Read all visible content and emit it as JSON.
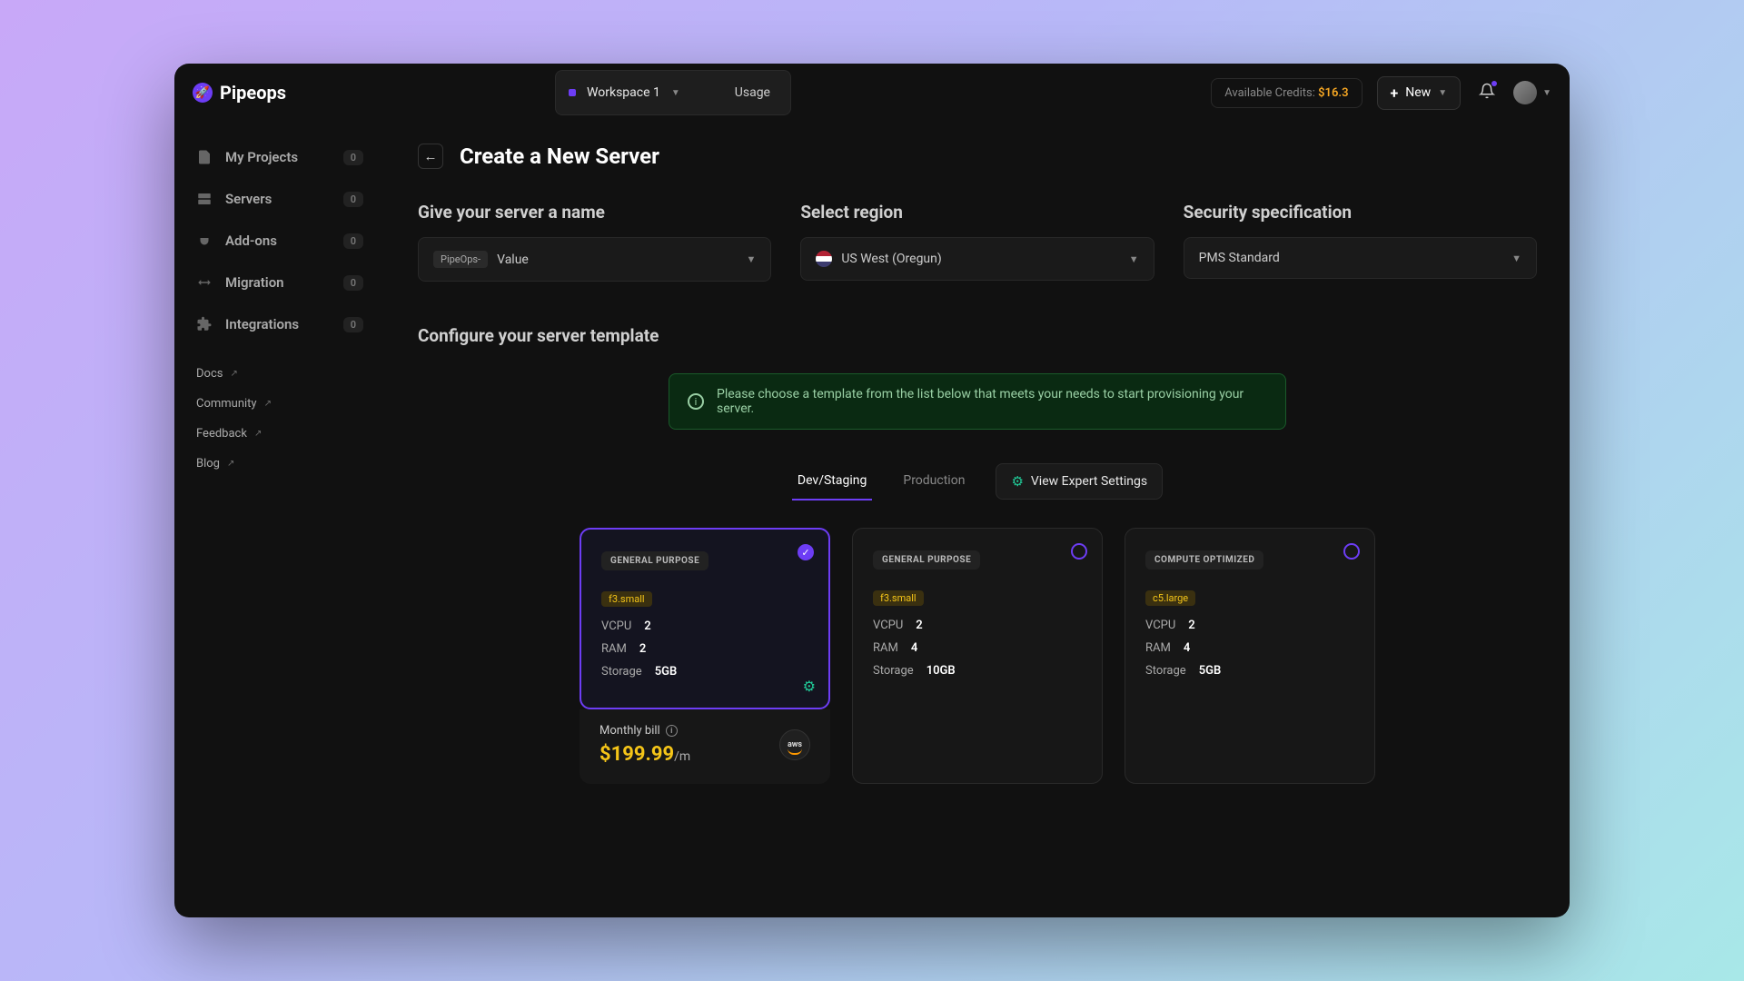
{
  "brand": "Pipeops",
  "topbar": {
    "workspace_label": "Workspace 1",
    "usage_label": "Usage",
    "credits_prefix": "Available Credits:",
    "credits_value": "$16.3",
    "new_button": "New"
  },
  "sidebar": {
    "items": [
      {
        "label": "My Projects",
        "badge": "0"
      },
      {
        "label": "Servers",
        "badge": "0"
      },
      {
        "label": "Add-ons",
        "badge": "0"
      },
      {
        "label": "Migration",
        "badge": "0"
      },
      {
        "label": "Integrations",
        "badge": "0"
      }
    ],
    "links": [
      {
        "label": "Docs"
      },
      {
        "label": "Community"
      },
      {
        "label": "Feedback"
      },
      {
        "label": "Blog"
      }
    ]
  },
  "page": {
    "title": "Create a New Server",
    "name_label": "Give your server a name",
    "name_prefix": "PipeOps-",
    "name_value": "Value",
    "region_label": "Select region",
    "region_value": "US West (Oregun)",
    "security_label": "Security specification",
    "security_value": "PMS Standard",
    "template_title": "Configure your server template",
    "info_banner": "Please choose a template from the list below that meets your needs to start provisioning your server.",
    "tabs": {
      "dev": "Dev/Staging",
      "prod": "Production",
      "expert": "View Expert Settings"
    },
    "spec_labels": {
      "vcpu": "VCPU",
      "ram": "RAM",
      "storage": "Storage"
    },
    "templates": [
      {
        "category": "GENERAL PURPOSE",
        "instance": "f3.small",
        "vcpu": "2",
        "ram": "2",
        "storage": "5GB",
        "selected": true
      },
      {
        "category": "GENERAL PURPOSE",
        "instance": "f3.small",
        "vcpu": "2",
        "ram": "4",
        "storage": "10GB",
        "selected": false
      },
      {
        "category": "COMPUTE OPTIMIZED",
        "instance": "c5.large",
        "vcpu": "2",
        "ram": "4",
        "storage": "5GB",
        "selected": false
      }
    ],
    "billing": {
      "label": "Monthly bill",
      "amount": "$199.99",
      "period": "/m",
      "provider": "aws"
    }
  }
}
